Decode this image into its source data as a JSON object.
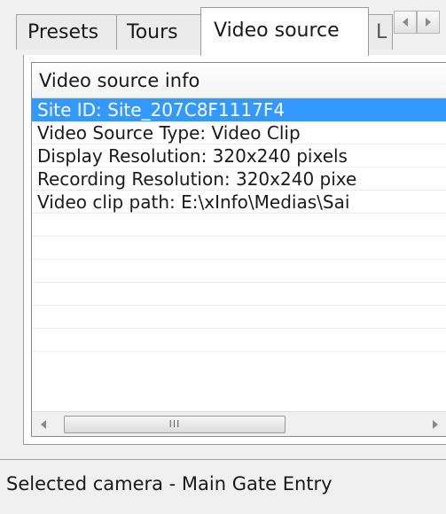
{
  "tabs": [
    {
      "label": "Presets"
    },
    {
      "label": "Tours"
    },
    {
      "label": "Video source"
    },
    {
      "label": "L"
    }
  ],
  "list": {
    "header": "Video source info",
    "rows": [
      "Site ID: Site_207C8F1117F4",
      "Video Source Type: Video Clip",
      "Display Resolution: 320x240 pixels",
      "Recording Resolution: 320x240 pixe",
      "Video clip path: E:\\xInfo\\Medias\\Sai"
    ],
    "selected_index": 0
  },
  "scrollbar": {
    "thumb_grip": "III"
  },
  "status": "Selected camera - Main Gate Entry"
}
